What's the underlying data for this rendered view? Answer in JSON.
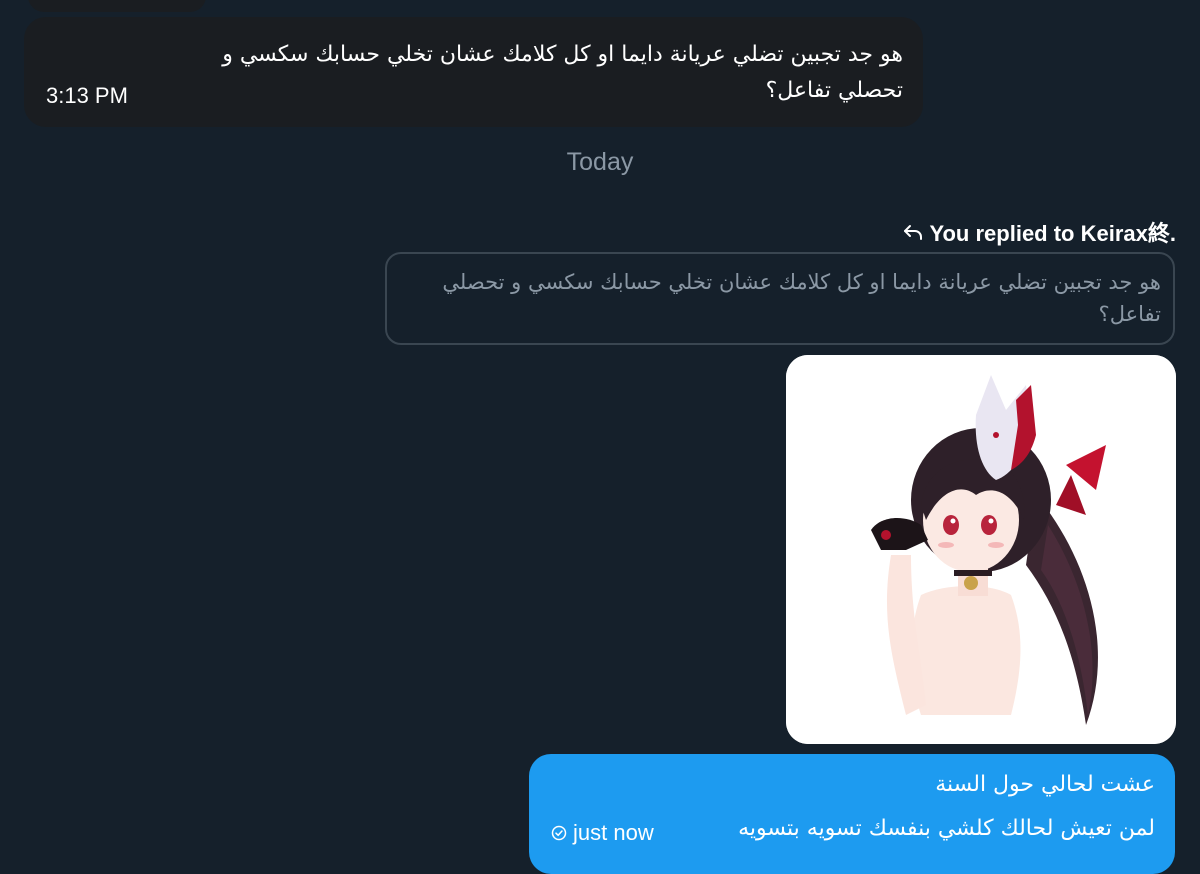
{
  "incoming_message": {
    "text": "هو جد تجبين تضلي عريانة دايما او كل كلامك عشان تخلي حسابك سكسي و تحصلي تفاعل؟",
    "time": "3:13 PM"
  },
  "date_separator": "Today",
  "reply_context": {
    "label": "You replied to Keirax終.",
    "icon": "reply-arrow-icon",
    "quoted_text": "هو جد تجبين تضلي عريانة دايما او كل كلامك عشان تخلي حسابك سكسي و تحصلي تفاعل؟"
  },
  "outgoing_message": {
    "line1": "عشت لحالي حول السنة",
    "line2": "لمن تعيش لحالك كلشي بنفسك تسويه بتسويه",
    "status": "just now",
    "status_icon": "sent-check-icon"
  },
  "colors": {
    "background": "#15202b",
    "incoming_bubble": "#1a1d21",
    "outgoing_bubble": "#1d9bf0",
    "muted_text": "#8b98a5"
  }
}
